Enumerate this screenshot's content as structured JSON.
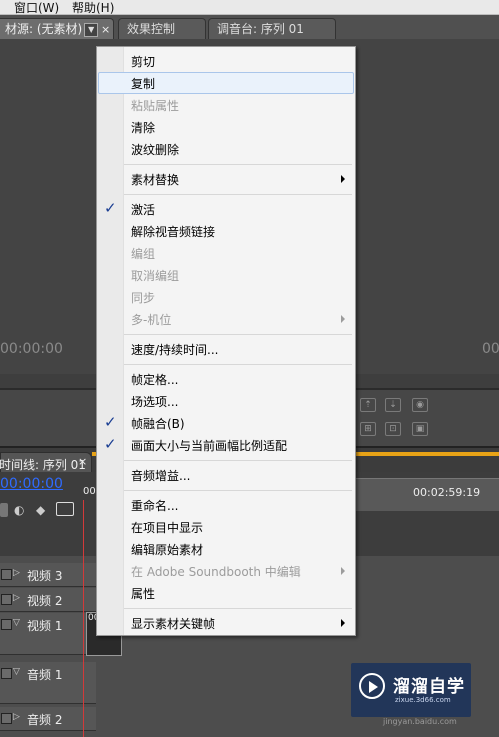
{
  "menubar": {
    "items": [
      "窗口(W)",
      "帮助(H)"
    ]
  },
  "tabs": {
    "source_label": "材源: (无素材)",
    "close_glyph": "×",
    "effects_label": "效果控制",
    "mixer_label": "调音台: 序列 01"
  },
  "monitor": {
    "timecode_left": "00:00:00",
    "timecode_right": "00"
  },
  "timeline": {
    "tab_label": "时间线: 序列 01",
    "close_glyph": "×",
    "timecode": "00:00:00",
    "ruler_time": "00:02:59:19",
    "ruler_time_start": "00",
    "clip_label": "00",
    "tracks": [
      {
        "label": "视频 3"
      },
      {
        "label": "视频 2"
      },
      {
        "label": "视频 1"
      },
      {
        "label": "音频 1"
      },
      {
        "label": "音频 2"
      }
    ]
  },
  "watermark": {
    "title": "溜溜自学",
    "subtitle": "zixue.3d66.com",
    "url": "jingyan.baidu.com"
  },
  "menu": {
    "items": [
      {
        "label": "剪切"
      },
      {
        "label": "复制"
      },
      {
        "label": "粘贴属性"
      },
      {
        "label": "清除"
      },
      {
        "label": "波纹删除"
      },
      {
        "label": "素材替换"
      },
      {
        "label": "激活"
      },
      {
        "label": "解除视音频链接"
      },
      {
        "label": "编组"
      },
      {
        "label": "取消编组"
      },
      {
        "label": "同步"
      },
      {
        "label": "多-机位"
      },
      {
        "label": "速度/持续时间..."
      },
      {
        "label": "帧定格..."
      },
      {
        "label": "场选项..."
      },
      {
        "label": "帧融合(B)"
      },
      {
        "label": "画面大小与当前画幅比例适配"
      },
      {
        "label": "音频增益..."
      },
      {
        "label": "重命名..."
      },
      {
        "label": "在项目中显示"
      },
      {
        "label": "编辑原始素材"
      },
      {
        "label": "在 Adobe Soundbooth 中编辑"
      },
      {
        "label": "属性"
      },
      {
        "label": "显示素材关键帧"
      }
    ]
  }
}
